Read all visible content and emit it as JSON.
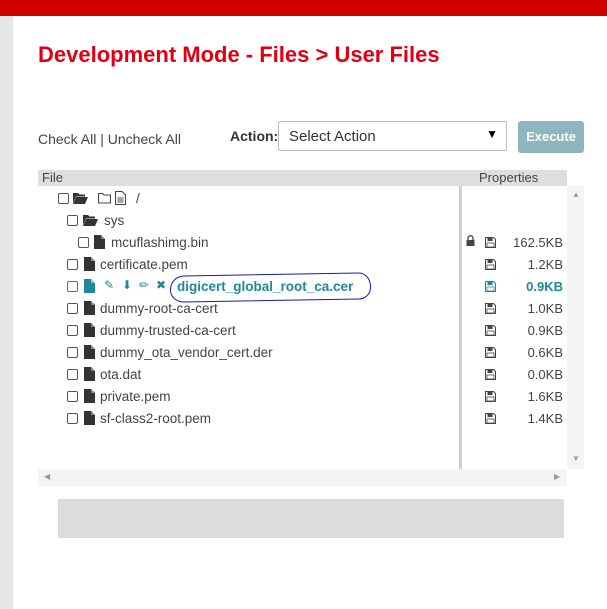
{
  "page": {
    "title": "Development Mode - Files > User Files"
  },
  "toolbar": {
    "check_all": "Check All",
    "separator": " | ",
    "uncheck_all": "Uncheck All",
    "action_label": "Action:",
    "select_value": "Select Action",
    "execute_label": "Execute"
  },
  "table": {
    "col_file": "File",
    "col_properties": "Properties"
  },
  "tree": {
    "root": {
      "name": "/"
    },
    "sys": {
      "name": "sys"
    },
    "mcuflash": {
      "name": "mcuflashimg.bin",
      "size": "162.5KB",
      "locked": true
    },
    "files": [
      {
        "name": "certificate.pem",
        "size": "1.2KB"
      },
      {
        "name": "digicert_global_root_ca.cer",
        "size": "0.9KB",
        "selected": true
      },
      {
        "name": "dummy-root-ca-cert",
        "size": "1.0KB"
      },
      {
        "name": "dummy-trusted-ca-cert",
        "size": "0.9KB"
      },
      {
        "name": "dummy_ota_vendor_cert.der",
        "size": "0.6KB"
      },
      {
        "name": "ota.dat",
        "size": "0.0KB"
      },
      {
        "name": "private.pem",
        "size": "1.6KB"
      },
      {
        "name": "sf-class2-root.pem",
        "size": "1.4KB"
      }
    ]
  },
  "colors": {
    "brand_red": "#e00012",
    "topbar_red": "#d10000",
    "selected_teal": "#1d8a99",
    "execute_bg": "#8fb5bf",
    "annotation_blue": "#1a1aa8"
  },
  "icons": {
    "folder_open": "folder-open-icon",
    "folder": "folder-icon",
    "file": "file-icon",
    "file_text": "file-text-icon",
    "lock": "lock-icon",
    "disk": "floppy-disk-icon",
    "edit": "edit-icon",
    "download": "download-icon",
    "rename": "pencil-icon",
    "delete": "delete-icon"
  }
}
